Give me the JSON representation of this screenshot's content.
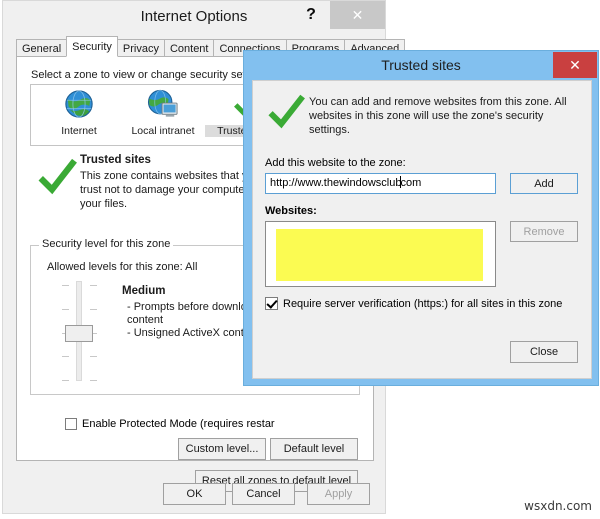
{
  "internet_options": {
    "title": "Internet Options",
    "help_icon": "question-mark-icon",
    "close_icon": "✕",
    "tabs": [
      {
        "label": "General",
        "active": false
      },
      {
        "label": "Security",
        "active": true
      },
      {
        "label": "Privacy",
        "active": false
      },
      {
        "label": "Content",
        "active": false
      },
      {
        "label": "Connections",
        "active": false
      },
      {
        "label": "Programs",
        "active": false
      },
      {
        "label": "Advanced",
        "active": false
      }
    ],
    "zone_select_label": "Select a zone to view or change security setting",
    "zones": [
      {
        "label": "Internet",
        "icon": "globe-icon",
        "selected": false
      },
      {
        "label": "Local intranet",
        "icon": "globe-monitor-icon",
        "selected": false
      },
      {
        "label": "Trusted sites",
        "icon": "green-check-icon",
        "selected": true
      }
    ],
    "zone_description": {
      "title": "Trusted sites",
      "body": "This zone contains websites that you trust not to damage your computer or your files.",
      "icon": "green-check-icon"
    },
    "security_level": {
      "legend": "Security level for this zone",
      "allowed": "Allowed levels for this zone: All",
      "level_name": "Medium",
      "level_desc": "- Prompts before downloading p content\n- Unsigned ActiveX controls will"
    },
    "protected_mode": {
      "label": "Enable Protected Mode (requires restar",
      "checked": false
    },
    "buttons": {
      "custom_level": "Custom level...",
      "default_level": "Default level",
      "reset_zones": "Reset all zones to default level",
      "ok": "OK",
      "cancel": "Cancel",
      "apply": "Apply"
    }
  },
  "trusted_sites_dialog": {
    "title": "Trusted sites",
    "close_icon": "✕",
    "info_icon": "green-check-icon",
    "info_text": "You can add and remove websites from this zone. All websites in this zone will use the zone's security settings.",
    "add_label": "Add this website to the zone:",
    "url_value_before_caret": "http://www.thewindowsclub",
    "url_value_after_caret": "com",
    "add_button": "Add",
    "websites_label": "Websites:",
    "websites_items": [],
    "remove_button": "Remove",
    "verify_label": "Require server verification (https:) for all sites in this zone",
    "verify_checked": true,
    "close_button": "Close",
    "highlight_color": "#fbfb52"
  },
  "watermark": "wsxdn.com"
}
